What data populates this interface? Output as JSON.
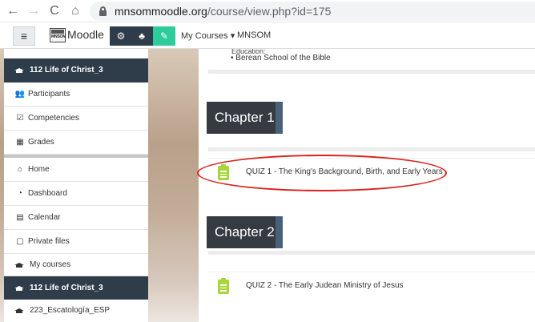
{
  "browser": {
    "back": "←",
    "forward": "→",
    "reload": "C",
    "home": "⌂",
    "url_host": "mnsommoodle.org",
    "url_path": "/course/view.php?id=175"
  },
  "navbar": {
    "menu": "≡",
    "logo_text": "MNSOM",
    "brand": "Moodle",
    "btn1": "⚙",
    "btn2": "♣",
    "btn3": "✎",
    "my_courses": "My Courses ▾",
    "site": "MNSOM"
  },
  "sidebar": {
    "course_title": "112 Life of Christ_3",
    "items": [
      {
        "icon": "👥",
        "label": "Participants"
      },
      {
        "icon": "☑",
        "label": "Competencies"
      },
      {
        "icon": "▦",
        "label": "Grades"
      }
    ],
    "nav": [
      {
        "icon": "⌂",
        "label": "Home"
      },
      {
        "icon": "◔",
        "label": "Dashboard"
      },
      {
        "icon": "▤",
        "label": "Calendar"
      },
      {
        "icon": "▢",
        "label": "Private files"
      },
      {
        "label": "My courses"
      }
    ],
    "active_course": "112 Life of Christ_3",
    "other_course": "223_Escatología_ESP"
  },
  "content": {
    "edu_cut": "Education:",
    "bullet": "•  Berean School of the Bible",
    "chapter1": "Chapter 1",
    "quiz1": "QUIZ 1 - The King's Background, Birth, and Early Years",
    "chapter2": "Chapter 2",
    "quiz2": "QUIZ 2 - The Early Judean Ministry of Jesus"
  },
  "colors": {
    "sidebar_dark": "#2f3d4b",
    "accent_green": "#2ecc9a",
    "quiz_icon": "#a6d63a",
    "chapter_bg": "#363b42",
    "highlight_circle": "#d9201b"
  }
}
